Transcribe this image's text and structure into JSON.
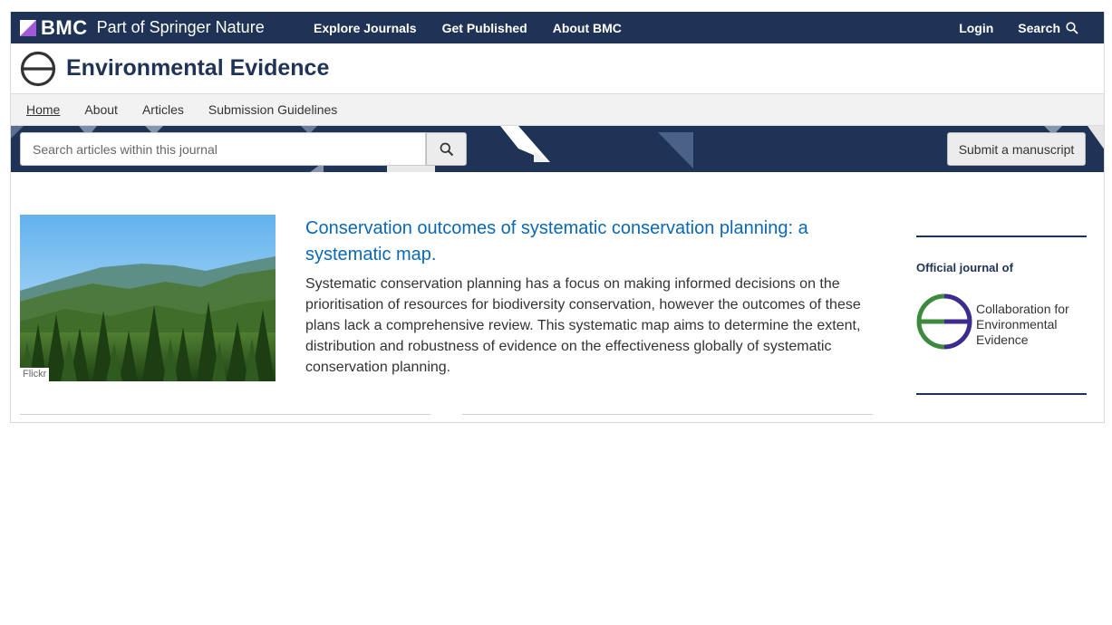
{
  "topbar": {
    "brand_bmc": "BMC",
    "brand_springer": "Part of Springer Nature",
    "nav": [
      "Explore Journals",
      "Get Published",
      "About BMC"
    ],
    "login": "Login",
    "search": "Search"
  },
  "journal": {
    "title": "Environmental Evidence"
  },
  "subnav": [
    "Home",
    "About",
    "Articles",
    "Submission Guidelines"
  ],
  "search": {
    "placeholder": "Search articles within this journal"
  },
  "submit_label": "Submit a manuscript",
  "article": {
    "image_credit": "Flickr",
    "title": "Conservation outcomes of systematic conservation planning: a systematic map.",
    "description": "Systematic conservation planning has a focus on making informed decisions on the prioritisation of resources for biodiversity conservation, however the outcomes of these plans lack a comprehensive review.  This systematic map aims to determine the extent, distribution and robustness of evidence on the effectiveness globally of systematic conservation planning."
  },
  "sidebar": {
    "official_label": "Official journal of",
    "cee_lines": [
      "Collaboration for",
      "Environmental",
      "Evidence"
    ]
  },
  "colors": {
    "navy": "#1e3356",
    "link_blue": "#0a68b4",
    "cee_green": "#3d8a3f",
    "cee_purple": "#3b2d8e",
    "bmc_purple": "#a15ad5"
  }
}
